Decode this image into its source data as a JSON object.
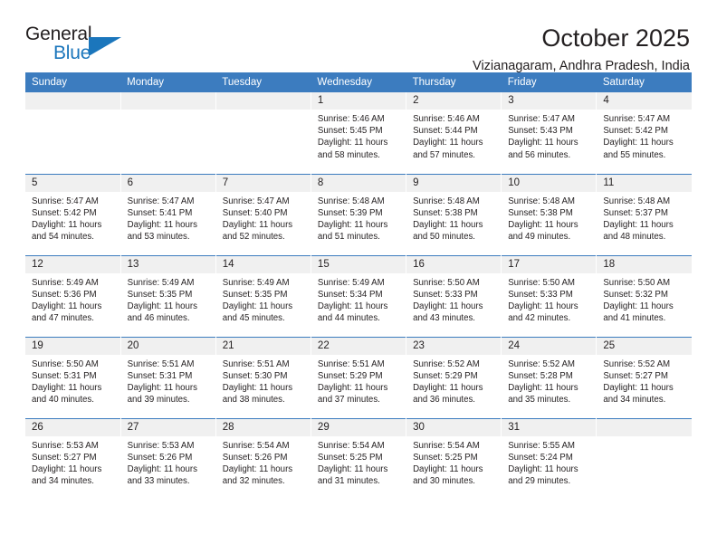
{
  "brand": {
    "name_top": "General",
    "name_bottom": "Blue",
    "accent_color": "#1b76bc",
    "triangle_icon": "brand-triangle-icon"
  },
  "header": {
    "title": "October 2025",
    "subtitle": "Vizianagaram, Andhra Pradesh, India",
    "header_bg": "#3c7cbf",
    "daynum_bg": "#f0f0f0"
  },
  "weekdays": [
    "Sunday",
    "Monday",
    "Tuesday",
    "Wednesday",
    "Thursday",
    "Friday",
    "Saturday"
  ],
  "labels": {
    "sunrise": "Sunrise:",
    "sunset": "Sunset:",
    "daylight": "Daylight:"
  },
  "weeks": [
    [
      {
        "day": "",
        "empty": true
      },
      {
        "day": "",
        "empty": true
      },
      {
        "day": "",
        "empty": true
      },
      {
        "day": "1",
        "sunrise": "Sunrise: 5:46 AM",
        "sunset": "Sunset: 5:45 PM",
        "daylight_1": "Daylight: 11 hours",
        "daylight_2": "and 58 minutes."
      },
      {
        "day": "2",
        "sunrise": "Sunrise: 5:46 AM",
        "sunset": "Sunset: 5:44 PM",
        "daylight_1": "Daylight: 11 hours",
        "daylight_2": "and 57 minutes."
      },
      {
        "day": "3",
        "sunrise": "Sunrise: 5:47 AM",
        "sunset": "Sunset: 5:43 PM",
        "daylight_1": "Daylight: 11 hours",
        "daylight_2": "and 56 minutes."
      },
      {
        "day": "4",
        "sunrise": "Sunrise: 5:47 AM",
        "sunset": "Sunset: 5:42 PM",
        "daylight_1": "Daylight: 11 hours",
        "daylight_2": "and 55 minutes."
      }
    ],
    [
      {
        "day": "5",
        "sunrise": "Sunrise: 5:47 AM",
        "sunset": "Sunset: 5:42 PM",
        "daylight_1": "Daylight: 11 hours",
        "daylight_2": "and 54 minutes."
      },
      {
        "day": "6",
        "sunrise": "Sunrise: 5:47 AM",
        "sunset": "Sunset: 5:41 PM",
        "daylight_1": "Daylight: 11 hours",
        "daylight_2": "and 53 minutes."
      },
      {
        "day": "7",
        "sunrise": "Sunrise: 5:47 AM",
        "sunset": "Sunset: 5:40 PM",
        "daylight_1": "Daylight: 11 hours",
        "daylight_2": "and 52 minutes."
      },
      {
        "day": "8",
        "sunrise": "Sunrise: 5:48 AM",
        "sunset": "Sunset: 5:39 PM",
        "daylight_1": "Daylight: 11 hours",
        "daylight_2": "and 51 minutes."
      },
      {
        "day": "9",
        "sunrise": "Sunrise: 5:48 AM",
        "sunset": "Sunset: 5:38 PM",
        "daylight_1": "Daylight: 11 hours",
        "daylight_2": "and 50 minutes."
      },
      {
        "day": "10",
        "sunrise": "Sunrise: 5:48 AM",
        "sunset": "Sunset: 5:38 PM",
        "daylight_1": "Daylight: 11 hours",
        "daylight_2": "and 49 minutes."
      },
      {
        "day": "11",
        "sunrise": "Sunrise: 5:48 AM",
        "sunset": "Sunset: 5:37 PM",
        "daylight_1": "Daylight: 11 hours",
        "daylight_2": "and 48 minutes."
      }
    ],
    [
      {
        "day": "12",
        "sunrise": "Sunrise: 5:49 AM",
        "sunset": "Sunset: 5:36 PM",
        "daylight_1": "Daylight: 11 hours",
        "daylight_2": "and 47 minutes."
      },
      {
        "day": "13",
        "sunrise": "Sunrise: 5:49 AM",
        "sunset": "Sunset: 5:35 PM",
        "daylight_1": "Daylight: 11 hours",
        "daylight_2": "and 46 minutes."
      },
      {
        "day": "14",
        "sunrise": "Sunrise: 5:49 AM",
        "sunset": "Sunset: 5:35 PM",
        "daylight_1": "Daylight: 11 hours",
        "daylight_2": "and 45 minutes."
      },
      {
        "day": "15",
        "sunrise": "Sunrise: 5:49 AM",
        "sunset": "Sunset: 5:34 PM",
        "daylight_1": "Daylight: 11 hours",
        "daylight_2": "and 44 minutes."
      },
      {
        "day": "16",
        "sunrise": "Sunrise: 5:50 AM",
        "sunset": "Sunset: 5:33 PM",
        "daylight_1": "Daylight: 11 hours",
        "daylight_2": "and 43 minutes."
      },
      {
        "day": "17",
        "sunrise": "Sunrise: 5:50 AM",
        "sunset": "Sunset: 5:33 PM",
        "daylight_1": "Daylight: 11 hours",
        "daylight_2": "and 42 minutes."
      },
      {
        "day": "18",
        "sunrise": "Sunrise: 5:50 AM",
        "sunset": "Sunset: 5:32 PM",
        "daylight_1": "Daylight: 11 hours",
        "daylight_2": "and 41 minutes."
      }
    ],
    [
      {
        "day": "19",
        "sunrise": "Sunrise: 5:50 AM",
        "sunset": "Sunset: 5:31 PM",
        "daylight_1": "Daylight: 11 hours",
        "daylight_2": "and 40 minutes."
      },
      {
        "day": "20",
        "sunrise": "Sunrise: 5:51 AM",
        "sunset": "Sunset: 5:31 PM",
        "daylight_1": "Daylight: 11 hours",
        "daylight_2": "and 39 minutes."
      },
      {
        "day": "21",
        "sunrise": "Sunrise: 5:51 AM",
        "sunset": "Sunset: 5:30 PM",
        "daylight_1": "Daylight: 11 hours",
        "daylight_2": "and 38 minutes."
      },
      {
        "day": "22",
        "sunrise": "Sunrise: 5:51 AM",
        "sunset": "Sunset: 5:29 PM",
        "daylight_1": "Daylight: 11 hours",
        "daylight_2": "and 37 minutes."
      },
      {
        "day": "23",
        "sunrise": "Sunrise: 5:52 AM",
        "sunset": "Sunset: 5:29 PM",
        "daylight_1": "Daylight: 11 hours",
        "daylight_2": "and 36 minutes."
      },
      {
        "day": "24",
        "sunrise": "Sunrise: 5:52 AM",
        "sunset": "Sunset: 5:28 PM",
        "daylight_1": "Daylight: 11 hours",
        "daylight_2": "and 35 minutes."
      },
      {
        "day": "25",
        "sunrise": "Sunrise: 5:52 AM",
        "sunset": "Sunset: 5:27 PM",
        "daylight_1": "Daylight: 11 hours",
        "daylight_2": "and 34 minutes."
      }
    ],
    [
      {
        "day": "26",
        "sunrise": "Sunrise: 5:53 AM",
        "sunset": "Sunset: 5:27 PM",
        "daylight_1": "Daylight: 11 hours",
        "daylight_2": "and 34 minutes."
      },
      {
        "day": "27",
        "sunrise": "Sunrise: 5:53 AM",
        "sunset": "Sunset: 5:26 PM",
        "daylight_1": "Daylight: 11 hours",
        "daylight_2": "and 33 minutes."
      },
      {
        "day": "28",
        "sunrise": "Sunrise: 5:54 AM",
        "sunset": "Sunset: 5:26 PM",
        "daylight_1": "Daylight: 11 hours",
        "daylight_2": "and 32 minutes."
      },
      {
        "day": "29",
        "sunrise": "Sunrise: 5:54 AM",
        "sunset": "Sunset: 5:25 PM",
        "daylight_1": "Daylight: 11 hours",
        "daylight_2": "and 31 minutes."
      },
      {
        "day": "30",
        "sunrise": "Sunrise: 5:54 AM",
        "sunset": "Sunset: 5:25 PM",
        "daylight_1": "Daylight: 11 hours",
        "daylight_2": "and 30 minutes."
      },
      {
        "day": "31",
        "sunrise": "Sunrise: 5:55 AM",
        "sunset": "Sunset: 5:24 PM",
        "daylight_1": "Daylight: 11 hours",
        "daylight_2": "and 29 minutes."
      },
      {
        "day": "",
        "empty": true
      }
    ]
  ]
}
